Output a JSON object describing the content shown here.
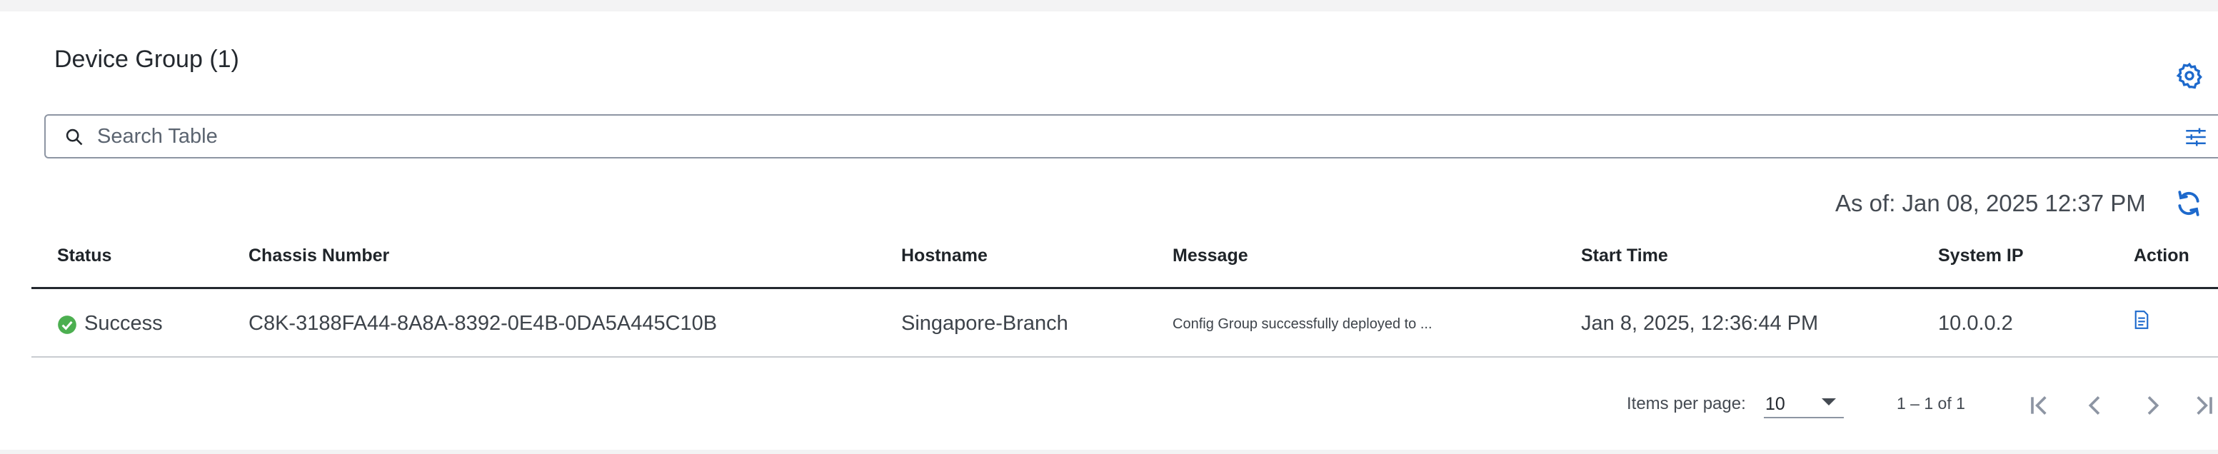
{
  "header": {
    "title": "Device Group (1)",
    "settings_icon": "gear-icon"
  },
  "search": {
    "placeholder": "Search Table",
    "value": "",
    "filter_icon": "filter-sliders-icon"
  },
  "toolbar": {
    "as_of": "As of: Jan 08, 2025 12:37 PM",
    "refresh_icon": "refresh-icon"
  },
  "table": {
    "columns": [
      "Status",
      "Chassis Number",
      "Hostname",
      "Message",
      "Start Time",
      "System IP",
      "Action"
    ],
    "rows": [
      {
        "status": "Success",
        "status_icon": "success-check-icon",
        "chassis": "C8K-3188FA44-8A8A-8392-0E4B-0DA5A445C10B",
        "hostname": "Singapore-Branch",
        "message": "Config Group successfully deployed to ...",
        "start_time": "Jan 8, 2025, 12:36:44 PM",
        "system_ip": "10.0.0.2",
        "action_icon": "document-icon"
      }
    ]
  },
  "pager": {
    "items_label": "Items per page:",
    "page_size": "10",
    "range": "1 – 1 of 1"
  },
  "colors": {
    "accent": "#1d69cc",
    "success": "#4caf50",
    "border": "#8d95a3"
  }
}
